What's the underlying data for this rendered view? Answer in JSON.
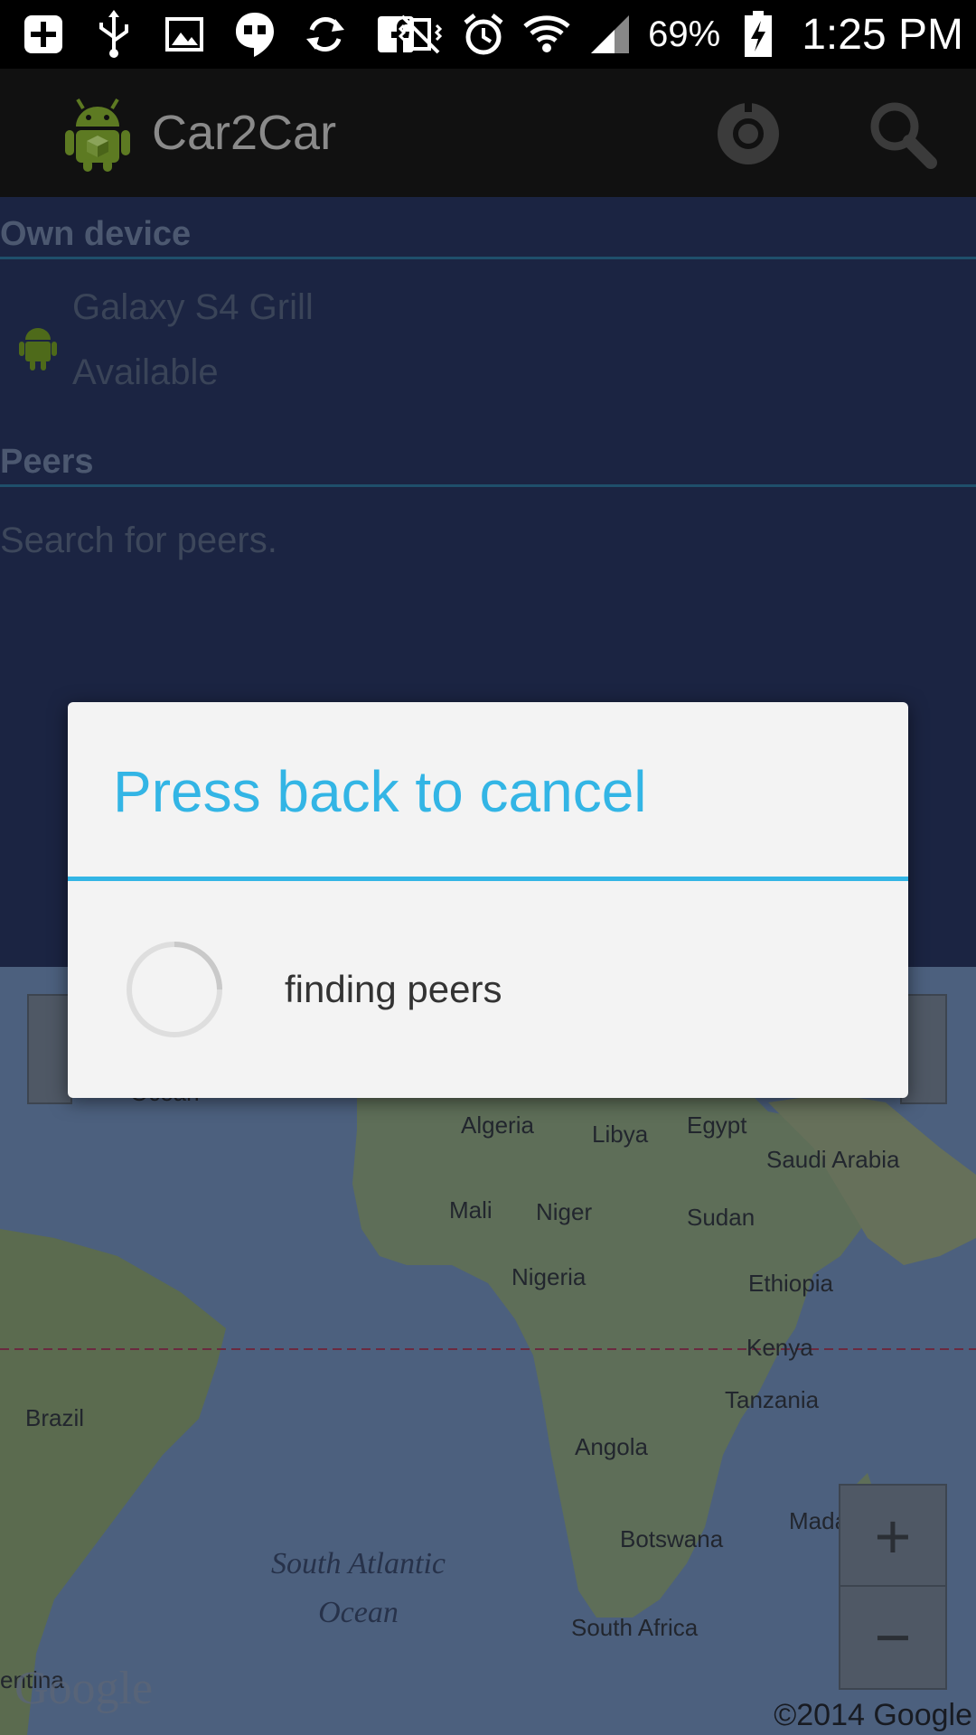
{
  "status_bar": {
    "icons_left": [
      "add-icon",
      "usb-icon",
      "image-icon",
      "hangouts-icon",
      "sync-icon",
      "facebook-icon"
    ],
    "icons_right": [
      "mute-vibrate-icon",
      "alarm-icon",
      "wifi-icon",
      "signal-icon",
      "battery-charging-icon"
    ],
    "battery": "69%",
    "time": "1:25 PM"
  },
  "action_bar": {
    "title": "Car2Car",
    "actions": [
      "settings-icon",
      "search-icon"
    ]
  },
  "own_device": {
    "header": "Own device",
    "name": "Galaxy S4 Grill",
    "status": "Available"
  },
  "peers": {
    "header": "Peers",
    "empty_text": "Search for peers."
  },
  "map": {
    "labels": [
      "Algeria",
      "Libya",
      "Egypt",
      "Saudi Arabia",
      "Mali",
      "Niger",
      "Sudan",
      "Nigeria",
      "Ethiopia",
      "Kenya",
      "Brazil",
      "Tanzania",
      "Angola",
      "Madagascar",
      "Botswana",
      "South Africa",
      "entina",
      "Ocean"
    ],
    "ocean_label": "South Atlantic\nOcean",
    "zoom_in": "+",
    "zoom_out": "−",
    "copyright": "©2014 Google",
    "logo": "Google"
  },
  "dialog": {
    "title": "Press back to cancel",
    "message": "finding peers"
  },
  "colors": {
    "accent": "#33b5e5",
    "actionbar": "#111111",
    "list_bg": "#1b2442"
  }
}
